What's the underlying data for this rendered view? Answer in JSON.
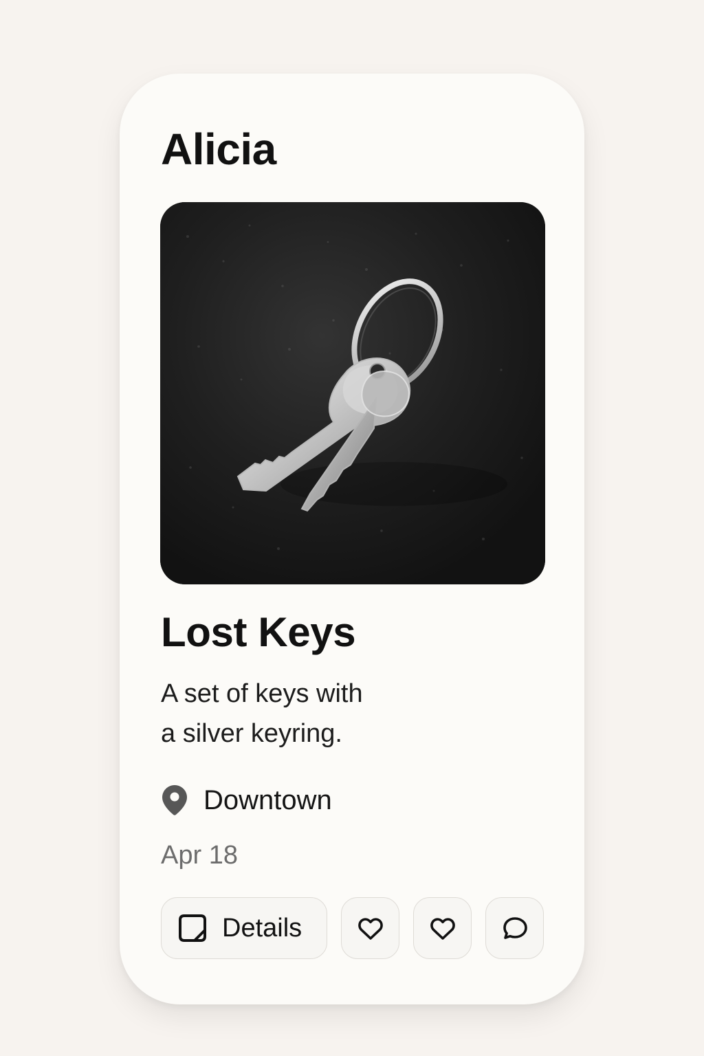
{
  "card": {
    "owner": "Alicia",
    "item_title": "Lost Keys",
    "description_lines": [
      "A set of keys with",
      "a silver keyring."
    ],
    "location": "Downtown",
    "date": "Apr 18"
  },
  "actions": {
    "details_label": "Details",
    "icons": [
      "heart-icon",
      "heart-icon",
      "comment-icon"
    ]
  },
  "theme": {
    "background": "#f7f3ef",
    "card": "#fcfbf8",
    "text": "#111111",
    "muted_text": "#6c6c6c",
    "button_border": "#dedbd6"
  },
  "icons": {
    "location": "location-pin-icon",
    "details": "details-icon"
  }
}
